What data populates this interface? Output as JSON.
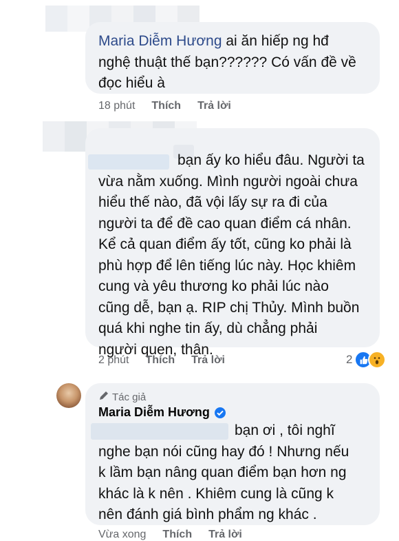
{
  "comment1": {
    "author": "Maria Diễm Hương",
    "text_line1": " ai ăn hiếp ng hđ",
    "text_line2": "nghệ thuật thế bạn?????? Có vấn đề về",
    "text_line3": "đọc hiểu à",
    "time": "18 phút",
    "like": "Thích",
    "reply": "Trả lời"
  },
  "comment2": {
    "lines": [
      "bạn ấy ko hiểu đâu. Người ta",
      "vừa nằm xuống. Mình người ngoài chưa",
      "hiểu thế nào, đã vội lấy sự ra đi của",
      "người ta để đề cao quan điểm cá nhân.",
      "Kể cả quan điểm ấy tốt, cũng ko phải là",
      "phù hợp để lên tiếng lúc này. Học khiêm",
      "cung và yêu thương ko phải lúc nào",
      "cũng dễ, bạn ạ. RIP chị Thủy. Mình buồn",
      "quá khi nghe tin ấy, dù chẳng phải",
      "người quen, thân."
    ],
    "time": "2 phút",
    "like": "Thích",
    "reply": "Trả lời",
    "reaction_count": "2"
  },
  "comment3": {
    "badge": "Tác giả",
    "author": "Maria Diễm Hương",
    "lines": [
      "bạn ơi , tôi nghĩ",
      "nghe bạn nói cũng hay đó ! Nhưng nếu",
      "k lầm bạn nâng quan điểm bạn hơn ng",
      "khác là k nên . Khiêm cung là cũng k",
      "nên đánh giá bình phẩm ng khác ."
    ],
    "time": "Vừa xong",
    "like": "Thích",
    "reply": "Trả lời"
  },
  "colors": {
    "bubble": "#f0f2f5",
    "name": "#2d4a8a",
    "meta": "#65676b",
    "like_blue": "#1877f2",
    "wow_yellow": "#f7b125"
  },
  "icons": [
    "pencil-icon",
    "verified-icon",
    "like-reaction-icon",
    "wow-reaction-icon"
  ]
}
